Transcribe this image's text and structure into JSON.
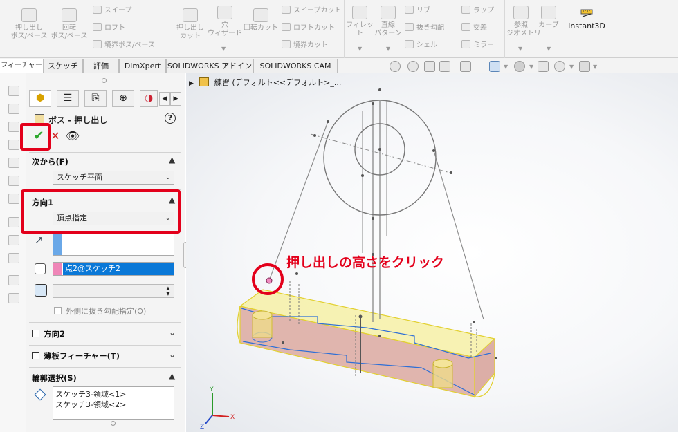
{
  "ribbon": {
    "extrude_boss": "押し出し\nボス/ベース",
    "revolve_boss": "回転\nボス/ベース",
    "sweep_boss": "スイープ",
    "loft_boss": "ロフト",
    "boundary_boss": "境界ボス/ベース",
    "extrude_cut": "押し出し\nカット",
    "hole_wizard": "穴\nウィザード",
    "revolve_cut": "回転カット",
    "sweep_cut": "スイープカット",
    "loft_cut": "ロフトカット",
    "boundary_cut": "境界カット",
    "fillet": "フィレット",
    "linear_pattern": "直線\nパターン",
    "rib": "リブ",
    "draft": "抜き勾配",
    "shell": "シェル",
    "wrap": "ラップ",
    "intersect": "交差",
    "mirror": "ミラー",
    "ref_geometry": "参照\nジオメトリ",
    "curves": "カーブ",
    "instant3d": "Instant3D"
  },
  "tabs": [
    "フィーチャー",
    "スケッチ",
    "評価",
    "DimXpert",
    "SOLIDWORKS アドイン",
    "SOLIDWORKS CAM"
  ],
  "pm": {
    "title": "ボス - 押し出し",
    "help": "?",
    "from_label": "次から(F)",
    "from_value": "スケッチ平面",
    "dir1_label": "方向1",
    "dir1_value": "頂点指定",
    "vertex_value": "点2@スケッチ2",
    "draft_outward": "外側に抜き勾配指定(O)",
    "dir2_label": "方向2",
    "thin_label": "薄板フィーチャー(T)",
    "contour_label": "輪郭選択(S)",
    "contours": [
      "スケッチ3-領域<1>",
      "スケッチ3-領域<2>"
    ]
  },
  "tree": {
    "label": "練習 (デフォルト<<デフォルト>_..."
  },
  "annotation": "押し出しの高さをクリック",
  "colors": {
    "annotation": "#e3001b",
    "ok_check": "#2ea82e",
    "cancel_x": "#d02020",
    "preview_top": "#f6ef9b",
    "preview_side": "#dca9a0",
    "sketch_edge": "#2e6fd6"
  }
}
